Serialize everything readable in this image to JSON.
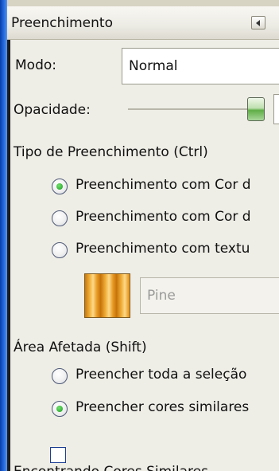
{
  "panel": {
    "title": "Preenchimento"
  },
  "mode": {
    "label": "Modo:",
    "value": "Normal"
  },
  "opacity": {
    "label": "Opacidade:"
  },
  "fill_type": {
    "heading": "Tipo de Preenchimento (Ctrl)",
    "options": [
      {
        "label": "Preenchimento com Cor d",
        "checked": true
      },
      {
        "label": "Preenchimento com Cor d",
        "checked": false
      },
      {
        "label": "Preenchimento com textu",
        "checked": false
      }
    ],
    "texture_name": "Pine"
  },
  "affected_area": {
    "heading": "Área Afetada (Shift)",
    "options": [
      {
        "label": "Preencher toda a seleção",
        "checked": false
      },
      {
        "label": "Preencher cores similares",
        "checked": true
      }
    ]
  },
  "similar_colors": {
    "heading": "Encontrando Cores Similares"
  },
  "colors": {
    "frame_blue": "#1f62d8",
    "radio_selected": "#1b9a22",
    "slider_green": "#5fae46"
  }
}
